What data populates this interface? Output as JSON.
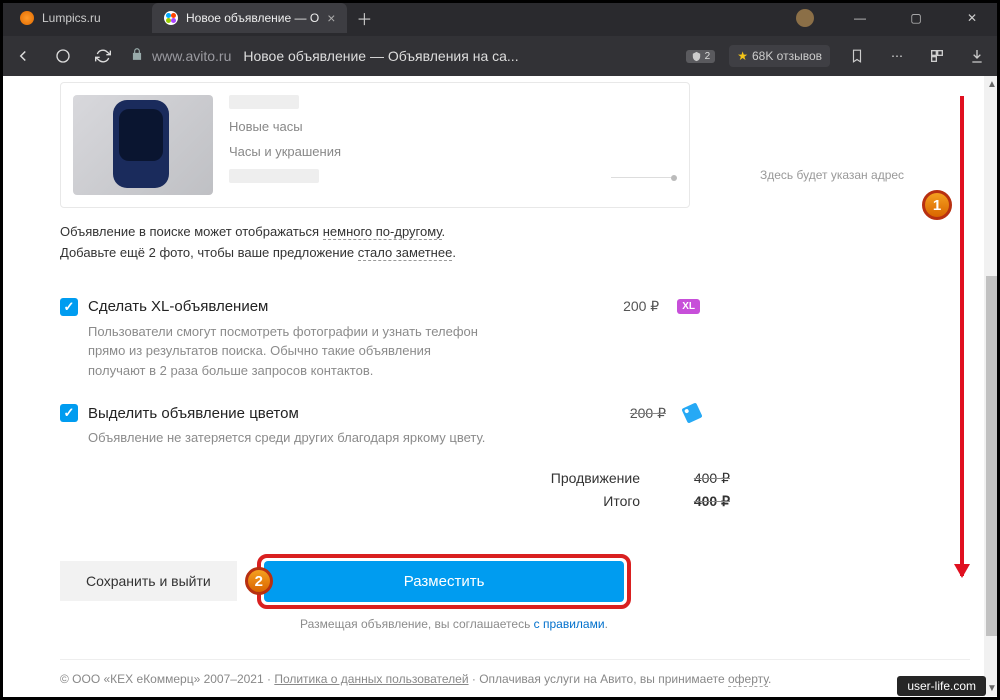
{
  "browser": {
    "tabs": [
      {
        "label": "Lumpics.ru"
      },
      {
        "label": "Новое объявление — О"
      }
    ],
    "url_host": "www.avito.ru",
    "url_title": "Новое объявление — Объявления на са...",
    "badge_count": "2",
    "reviews": "68K отзывов"
  },
  "preview": {
    "line1": "Новые часы",
    "line2": "Часы и украшения",
    "addr_hint": "Здесь будет указан адрес"
  },
  "hints": {
    "line1a": "Объявление в поиске может отображаться ",
    "line1b": "немного по-другому",
    "line1c": ".",
    "line2a": "Добавьте ещё 2 фото, чтобы ваше предложение ",
    "line2b": "стало заметнее",
    "line2c": "."
  },
  "options": {
    "xl": {
      "title": "Сделать XL-объявлением",
      "price": "200 ₽",
      "badge": "XL",
      "desc": "Пользователи смогут посмотреть фотографии и узнать телефон прямо из результатов поиска. Обычно такие объявления получают в 2 раза больше запросов контактов."
    },
    "color": {
      "title": "Выделить объявление цветом",
      "price": "200 ₽",
      "desc": "Объявление не затеряется среди других благодаря яркому цвету."
    }
  },
  "totals": {
    "promo_label": "Продвижение",
    "promo_value": "400 ₽",
    "total_label": "Итого",
    "total_value": "400 ₽"
  },
  "actions": {
    "save": "Сохранить и выйти",
    "submit": "Разместить",
    "terms_a": "Размещая объявление, вы соглашаетесь ",
    "terms_link": "с правилами",
    "terms_b": "."
  },
  "footer": {
    "company": "© ООО «КЕХ еКоммерц» 2007–2021 · ",
    "policy": "Политика о данных пользователей",
    "sep": " · Оплачивая услуги на Авито, вы принимаете ",
    "offer": "оферту"
  },
  "annotations": {
    "n1": "1",
    "n2": "2"
  },
  "watermark": "user-life.com"
}
